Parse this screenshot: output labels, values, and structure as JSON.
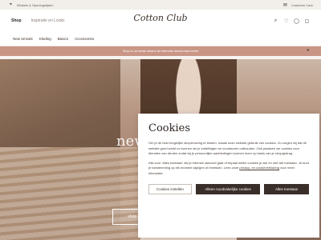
{
  "topbar": {
    "left_text": "Winkels & Openingstijden",
    "right_text": "Customer Care"
  },
  "header": {
    "nav_shop": "Shop",
    "nav_inspire": "Inspiratie en Looks",
    "logo": "Cotton Club"
  },
  "navbar": {
    "items": [
      "New arrivals",
      "Kleding",
      "Basics",
      "Accessories"
    ]
  },
  "promo": {
    "text": "Shop nu uw eerste ideas in de sfeervolle dames maar breekt"
  },
  "hero": {
    "headline": "new",
    "button": "shop new"
  },
  "cookie": {
    "title": "Cookies",
    "paragraph1": "Om je de best mogelijke shopervaring te bieden, maakt onze website gebruik van cookies. Zo zorgen wij dat de website goed werkt en kunnen we je instellingen en voorkeuren onthouden. Ook plaatsen we cookies voor diensten van derden zodat wij je persoonlijke aanbiedingen kunnen doen op basis van je shopgedrag.",
    "paragraph2_start": "Klik voor 'Alles toestaan' als je hiermee akkoord gaat of bepaal welke cookies je wel én niet wilt toestaan. Je kunt je toestemming op elk moment wijzigen of intrekken. Lees onze",
    "privacy_link": "privacy- en cookieverklaring",
    "paragraph2_end": "voor meer informatie.",
    "btn_settings": "Cookies instellen",
    "btn_necessary": "Alleen noodzakelijke cookies",
    "btn_accept": "Alles toestaan"
  }
}
